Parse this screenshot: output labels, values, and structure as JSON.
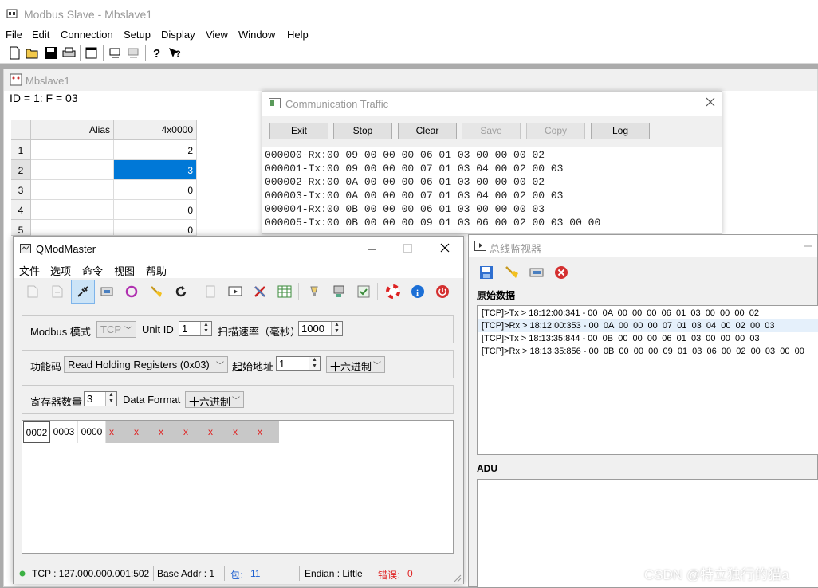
{
  "app": {
    "title": "Modbus Slave - Mbslave1",
    "menu": [
      "File",
      "Edit",
      "Connection",
      "Setup",
      "Display",
      "View",
      "Window",
      "Help"
    ]
  },
  "mbslave": {
    "title": "Mbslave1",
    "id_line": "ID = 1: F = 03",
    "col_alias": "Alias",
    "col_addr": "4x0000",
    "rows": [
      {
        "n": "1",
        "v": "2"
      },
      {
        "n": "2",
        "v": "3"
      },
      {
        "n": "3",
        "v": "0"
      },
      {
        "n": "4",
        "v": "0"
      },
      {
        "n": "5",
        "v": "0"
      }
    ]
  },
  "traffic": {
    "title": "Communication Traffic",
    "buttons": [
      "Exit",
      "Stop",
      "Clear",
      "Save",
      "Copy",
      "Log"
    ],
    "lines": [
      "000000-Rx:00 09 00 00 00 06 01 03 00 00 00 02",
      "000001-Tx:00 09 00 00 00 07 01 03 04 00 02 00 03",
      "000002-Rx:00 0A 00 00 00 06 01 03 00 00 00 02",
      "000003-Tx:00 0A 00 00 00 07 01 03 04 00 02 00 03",
      "000004-Rx:00 0B 00 00 00 06 01 03 00 00 00 03",
      "000005-Tx:00 0B 00 00 00 09 01 03 06 00 02 00 03 00 00"
    ]
  },
  "qmm": {
    "title": "QModMaster",
    "menu": [
      "文件",
      "选项",
      "命令",
      "视图",
      "帮助"
    ],
    "mode_label": "Modbus 模式",
    "mode_value": "TCP",
    "unit_label": "Unit ID",
    "unit_value": "1",
    "scan_label": "扫描速率（毫秒）",
    "scan_value": "1000",
    "func_label": "功能码",
    "func_value": "Read Holding Registers (0x03)",
    "start_label": "起始地址",
    "start_value": "1",
    "start_fmt": "十六进制",
    "count_label": "寄存器数量",
    "count_value": "3",
    "fmt_label": "Data Format",
    "fmt_value": "十六进制",
    "values": [
      "0002",
      "0003",
      "0000"
    ],
    "x_cells": [
      "x",
      "x",
      "x",
      "x",
      "x",
      "x",
      "x"
    ],
    "status": {
      "conn": "TCP : 127.000.000.001:502",
      "base": "Base Addr : 1",
      "pkt_label": "包:",
      "pkt_value": "11",
      "endian": "Endian : Little",
      "err_label": "错误:",
      "err_value": "0"
    }
  },
  "bus": {
    "title": "总线监视器",
    "raw_label": "原始数据",
    "adu_label": "ADU",
    "log": [
      "[TCP]>Tx > 18:12:00:341 - 00  0A  00  00  00  06  01  03  00  00  00  02",
      "[TCP]>Rx > 18:12:00:353 - 00  0A  00  00  00  07  01  03  04  00  02  00  03",
      "[TCP]>Tx > 18:13:35:844 - 00  0B  00  00  00  06  01  03  00  00  00  03",
      "[TCP]>Rx > 18:13:35:856 - 00  0B  00  00  00  09  01  03  06  00  02  00  03  00  00"
    ]
  },
  "watermark": "CSDN @特立独行的猫a",
  "colors": {
    "selected_cell": "#0078d7",
    "error_red": "#e02020",
    "status_blue": "#1c5fd0"
  }
}
